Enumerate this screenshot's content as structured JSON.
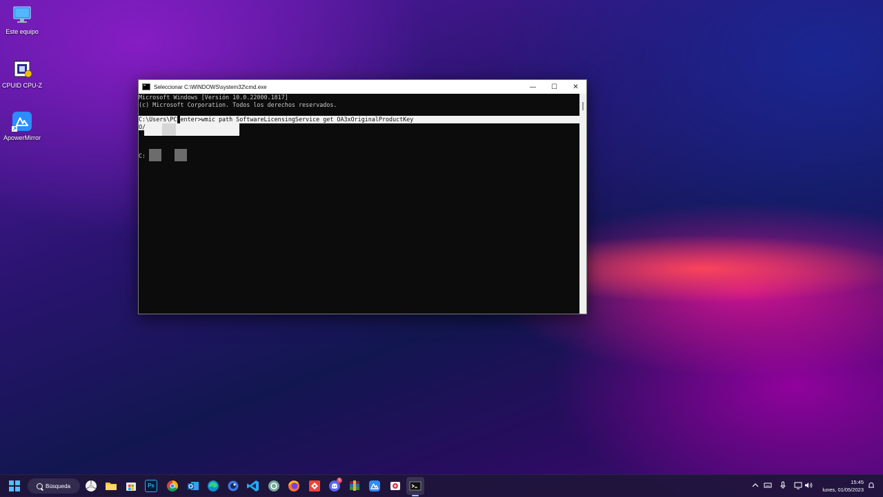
{
  "desktop": {
    "icons": [
      {
        "label": "Este equipo",
        "icon": "monitor-icon"
      },
      {
        "label": "CPUID CPU-Z",
        "icon": "cpu-z-icon"
      },
      {
        "label": "ApowerMirror",
        "icon": "apowermirror-icon"
      }
    ]
  },
  "window": {
    "title": "Seleccionar C:\\WINDOWS\\system32\\cmd.exe",
    "minimize_glyph": "—",
    "maximize_glyph": "☐",
    "close_glyph": "✕"
  },
  "console": {
    "lines": [
      "Microsoft Windows [Versión 10.0.22000.1817]",
      "(c) Microsoft Corporation. Todos los derechos reservados.",
      "",
      "C:\\Users\\PCcenter>wmic path SoftwareLicensingService get OA3xOriginalProductKey",
      "O/",
      "",
      "",
      "C:"
    ]
  },
  "taskbar": {
    "search_label": "Búsqueda",
    "apps": [
      "chrome-canary-icon",
      "file-explorer-icon",
      "store-icon",
      "photoshop-icon",
      "chrome-icon",
      "outlook-icon",
      "edge-icon",
      "browser-icon",
      "vscode-icon",
      "chatgpt-icon",
      "firefox-icon",
      "anydesk-icon",
      "discord-icon",
      "winrar-icon",
      "apowermirror-icon",
      "media-icon",
      "terminal-icon"
    ],
    "discord_badge": "5",
    "photoshop_label": "Ps",
    "clock_time": "15:45",
    "clock_date": "lunes, 01/05/2023"
  },
  "colors": {
    "console_bg": "#0c0c0c",
    "console_text": "#cccccc",
    "selection": "#f2f2f2",
    "accent": "#4cc2ff"
  }
}
